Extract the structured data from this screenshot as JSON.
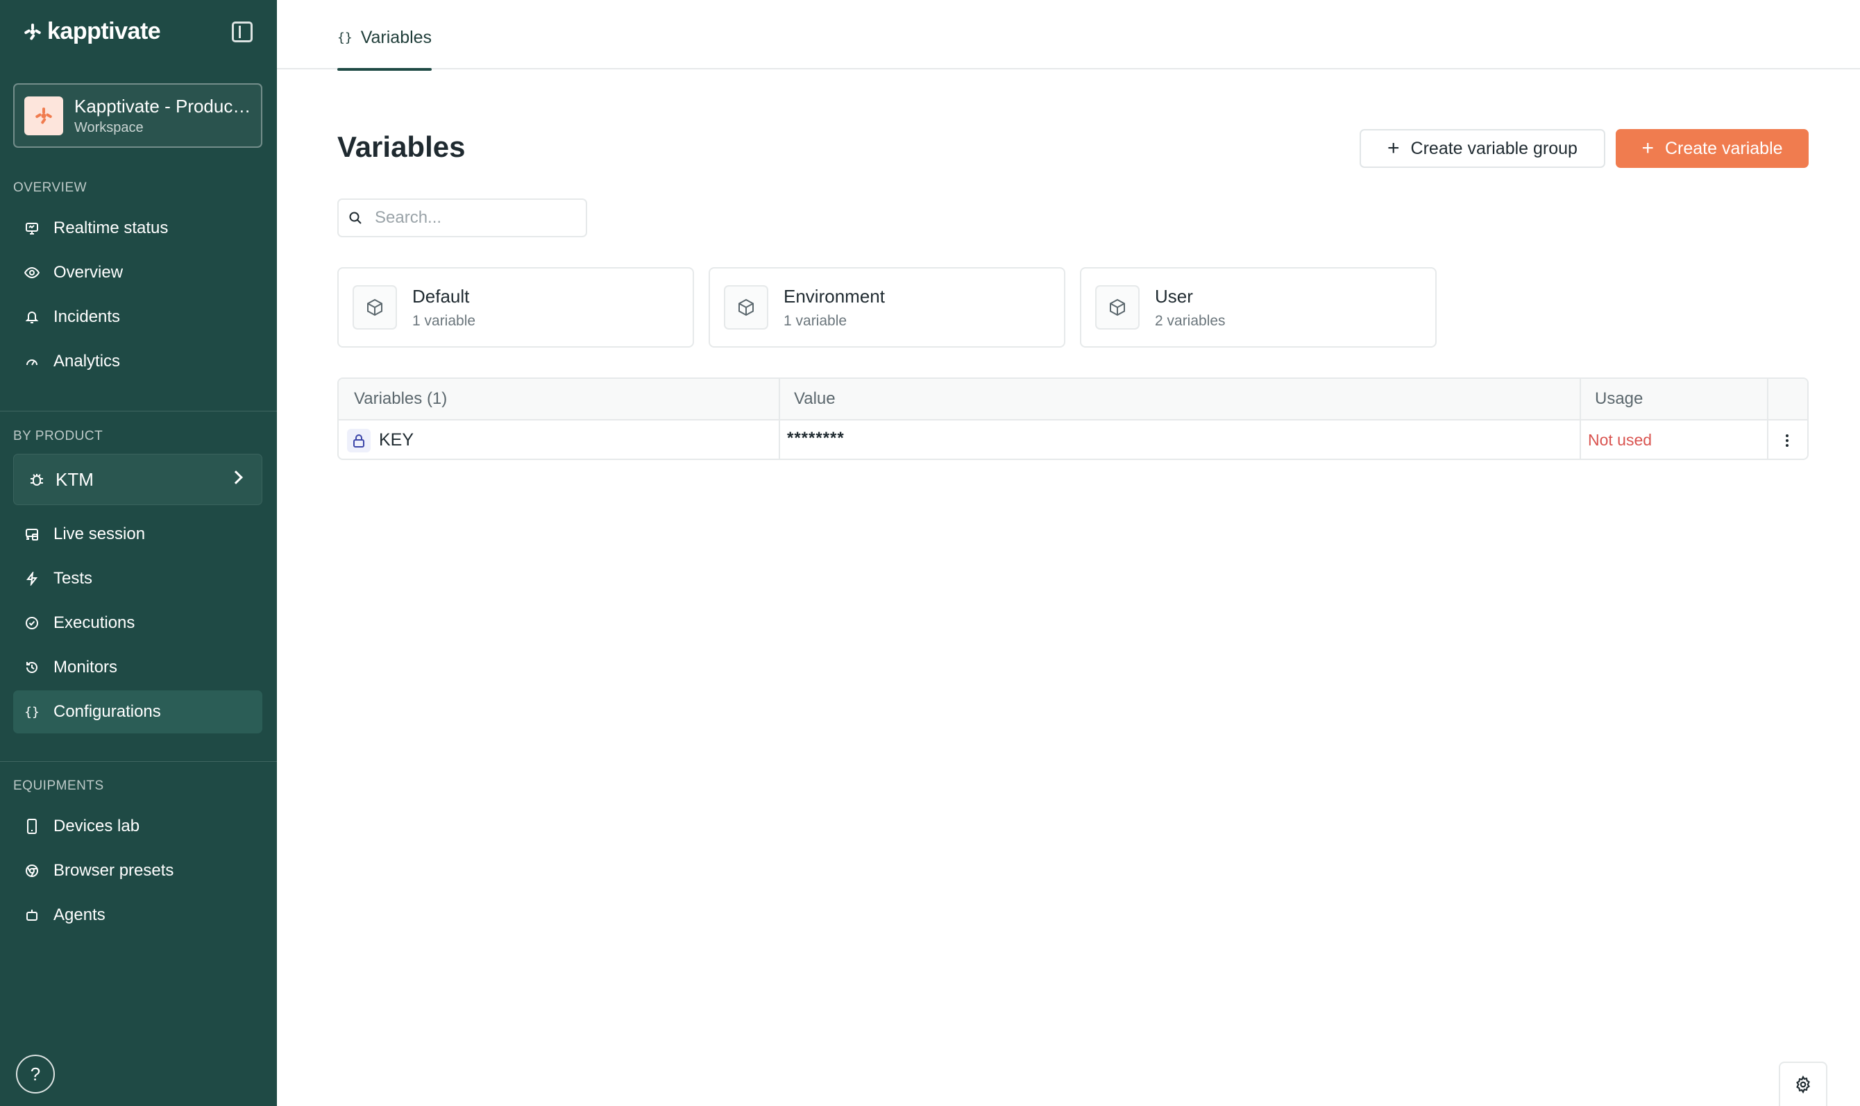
{
  "app": {
    "brand": "kapptivate",
    "workspace_name": "Kapptivate - Production",
    "workspace_type": "Workspace"
  },
  "sidebar": {
    "sections": {
      "overview": "OVERVIEW",
      "by_product": "BY PRODUCT",
      "equipments": "EQUIPMENTS"
    },
    "overview_items": [
      {
        "label": "Realtime status",
        "icon": "monitor-icon"
      },
      {
        "label": "Overview",
        "icon": "eye-icon"
      },
      {
        "label": "Incidents",
        "icon": "bell-icon"
      },
      {
        "label": "Analytics",
        "icon": "gauge-icon"
      }
    ],
    "product_selector": "KTM",
    "product_items": [
      {
        "label": "Live session",
        "icon": "cast-icon"
      },
      {
        "label": "Tests",
        "icon": "bolt-icon"
      },
      {
        "label": "Executions",
        "icon": "check-circle-icon"
      },
      {
        "label": "Monitors",
        "icon": "history-icon"
      },
      {
        "label": "Configurations",
        "icon": "braces-icon",
        "active": true
      }
    ],
    "equipment_items": [
      {
        "label": "Devices lab",
        "icon": "phone-icon"
      },
      {
        "label": "Browser presets",
        "icon": "chrome-icon"
      },
      {
        "label": "Agents",
        "icon": "robot-icon"
      }
    ],
    "help": "?"
  },
  "tabs": {
    "active": "Variables",
    "active_icon": "{}"
  },
  "page": {
    "title": "Variables",
    "create_group_label": "Create variable group",
    "create_variable_label": "Create variable",
    "search_placeholder": "Search..."
  },
  "groups": [
    {
      "name": "Default",
      "count": "1 variable"
    },
    {
      "name": "Environment",
      "count": "1 variable"
    },
    {
      "name": "User",
      "count": "2 variables"
    }
  ],
  "table": {
    "headers": [
      "Variables (1)",
      "Value",
      "Usage"
    ],
    "rows": [
      {
        "name": "KEY",
        "value": "********",
        "usage": "Not used"
      }
    ]
  },
  "colors": {
    "sidebar_bg": "#1f4a45",
    "accent": "#f07c4f",
    "danger": "#d9534f"
  }
}
